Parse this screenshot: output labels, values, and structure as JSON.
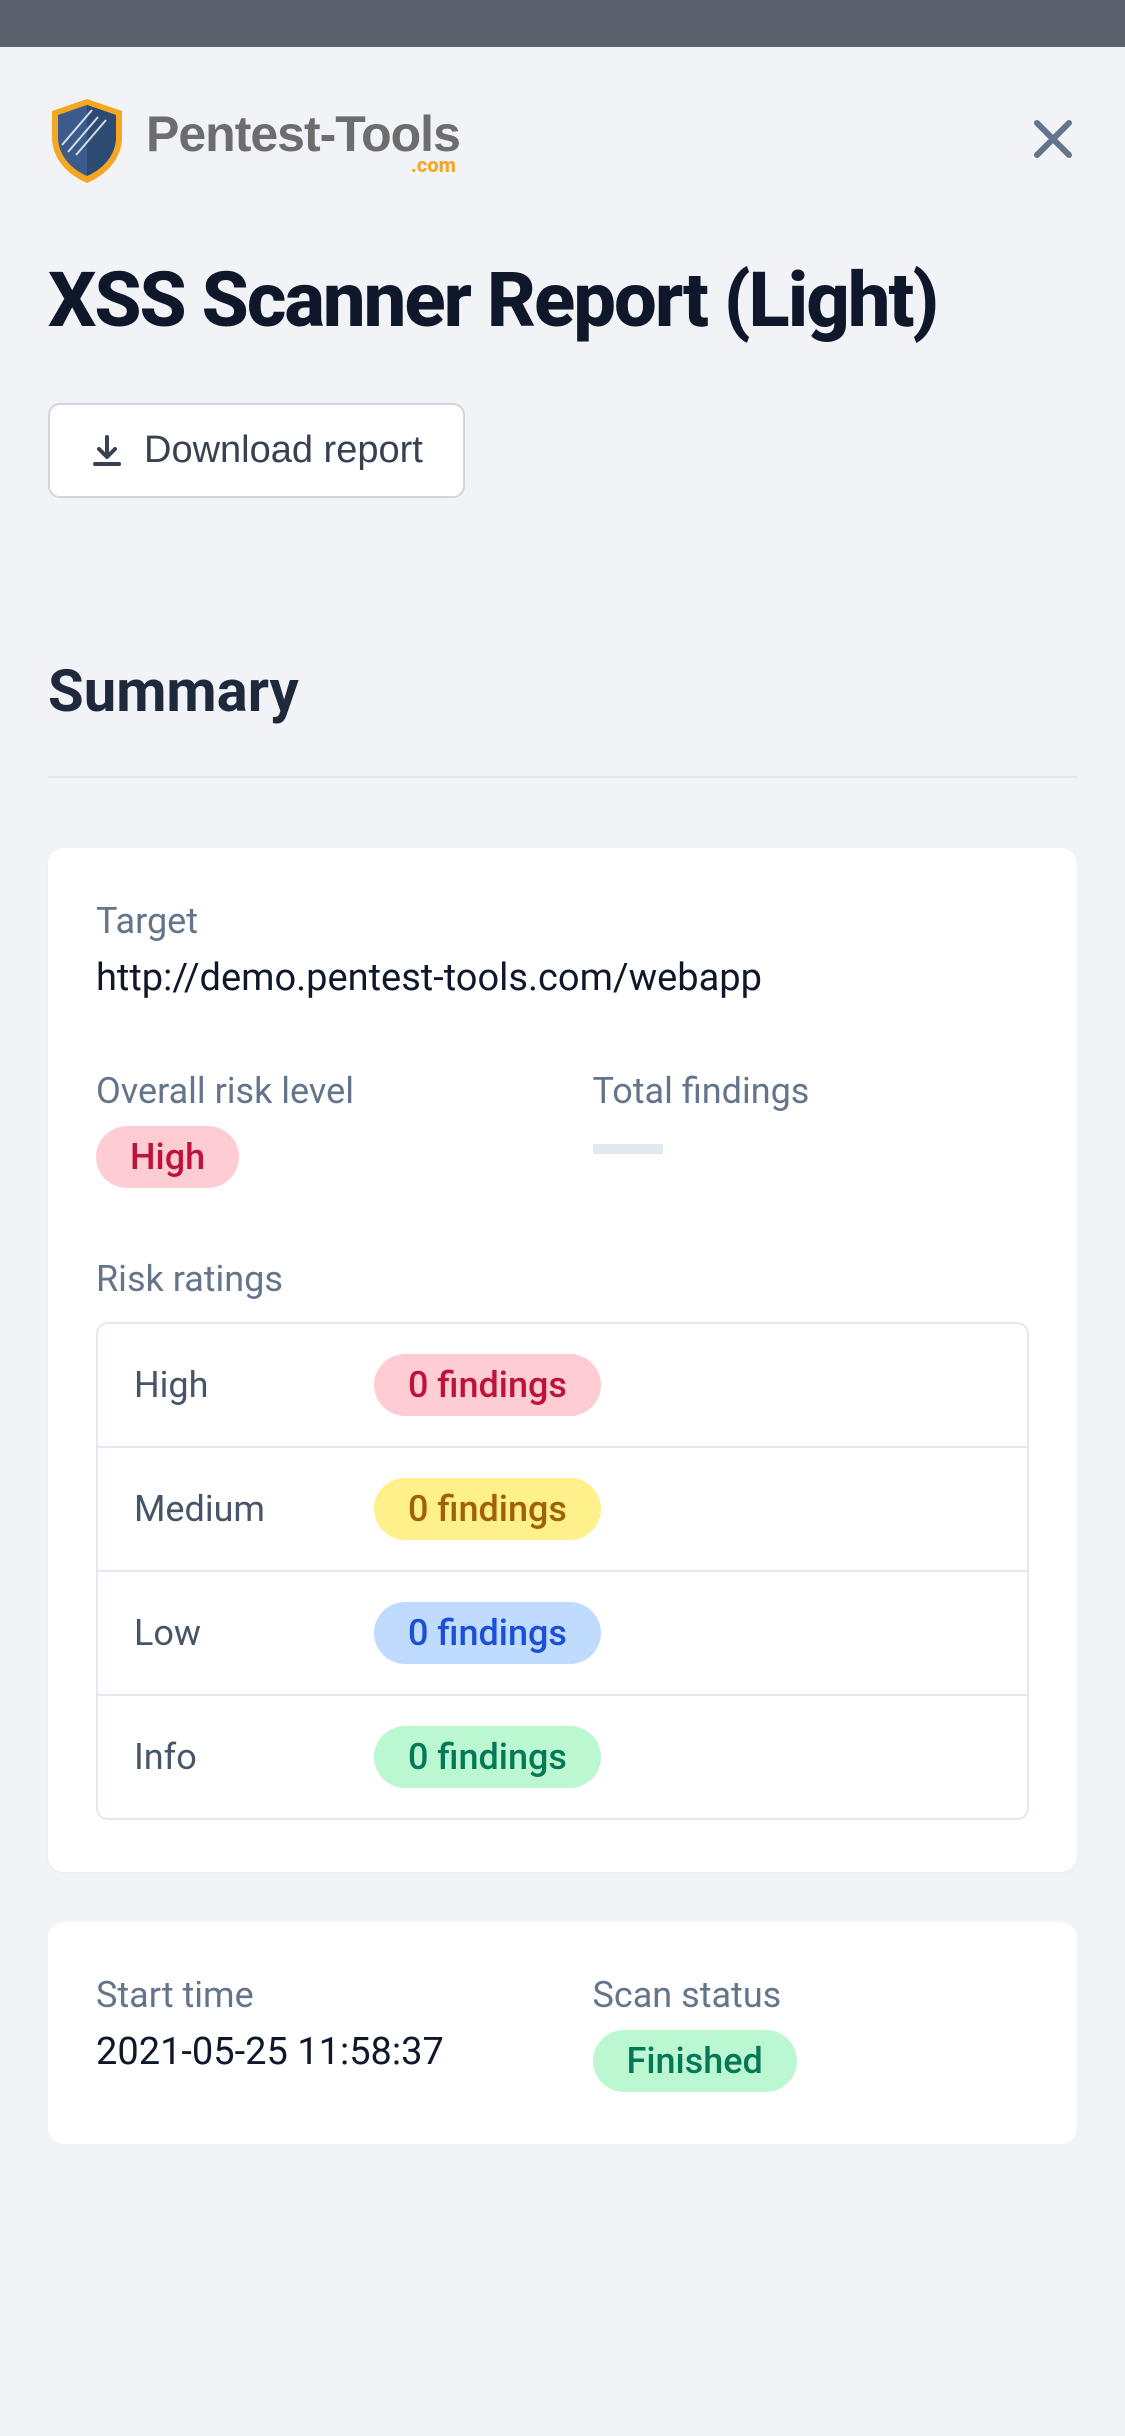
{
  "brand": {
    "name": "Pentest-Tools",
    "suffix": ".com"
  },
  "page_title": "XSS Scanner Report (Light)",
  "download_label": "Download report",
  "summary_heading": "Summary",
  "target": {
    "label": "Target",
    "value": "http://demo.pentest-tools.com/webapp"
  },
  "overall_risk": {
    "label": "Overall risk level",
    "value": "High"
  },
  "total_findings": {
    "label": "Total findings"
  },
  "risk_ratings": {
    "label": "Risk ratings",
    "rows": [
      {
        "name": "High",
        "count_text": "0 findings",
        "cls": "badge-high"
      },
      {
        "name": "Medium",
        "count_text": "0 findings",
        "cls": "badge-medium"
      },
      {
        "name": "Low",
        "count_text": "0 findings",
        "cls": "badge-low"
      },
      {
        "name": "Info",
        "count_text": "0 findings",
        "cls": "badge-info"
      }
    ]
  },
  "start_time": {
    "label": "Start time",
    "value": "2021-05-25 11:58:37"
  },
  "scan_status": {
    "label": "Scan status",
    "value": "Finished"
  }
}
